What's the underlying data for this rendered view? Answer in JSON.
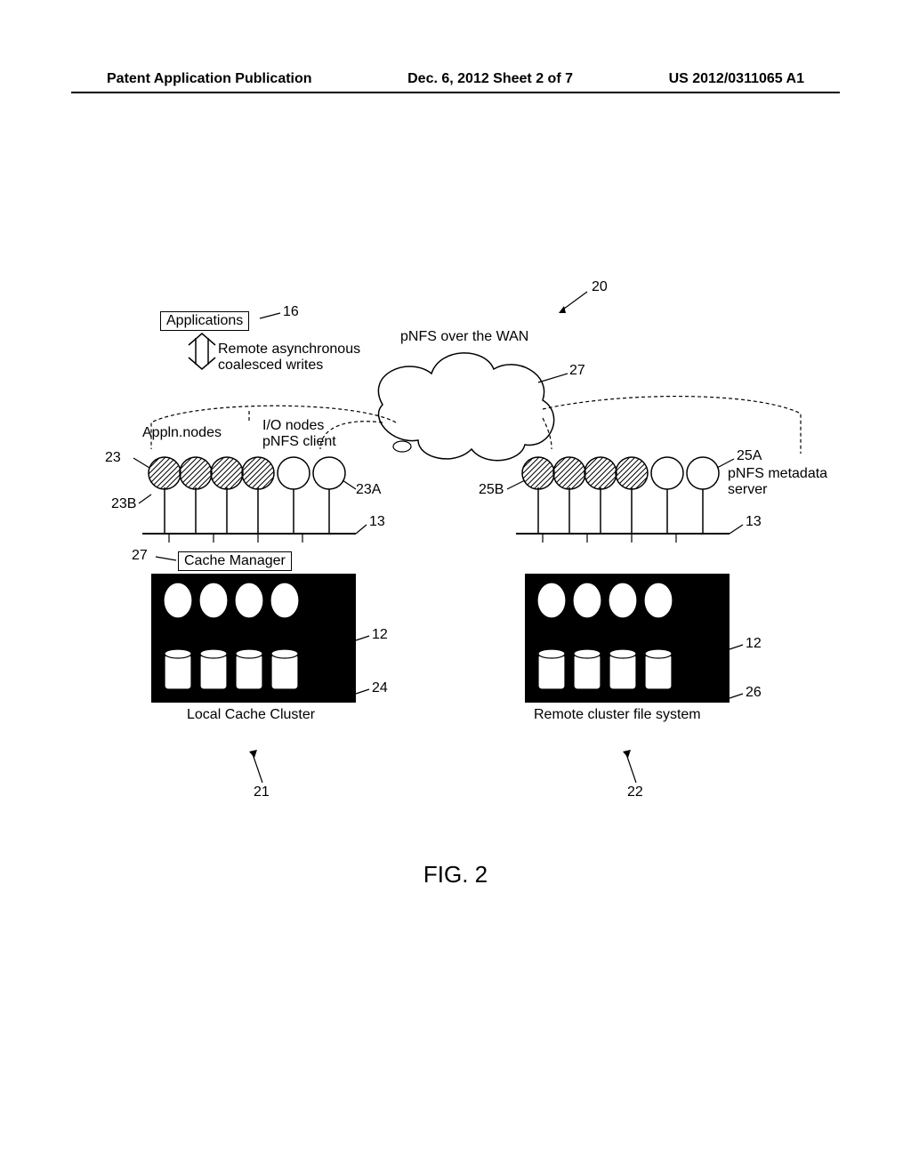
{
  "header": {
    "left": "Patent Application Publication",
    "center": "Dec. 6, 2012  Sheet 2 of 7",
    "right": "US 2012/0311065 A1"
  },
  "figure_label": "FIG. 2",
  "labels": {
    "applications": "Applications",
    "remote_async_l1": "Remote asynchronous",
    "remote_async_l2": "coalesced writes",
    "pnfs_wan": "pNFS over the WAN",
    "appln_nodes": "Appln.nodes",
    "io_nodes_l1": "I/O nodes",
    "io_nodes_l2": "pNFS client",
    "pnfs_meta_l1": "pNFS metadata",
    "pnfs_meta_l2": "server",
    "cache_manager": "Cache Manager",
    "local_cache": "Local Cache Cluster",
    "remote_fs": "Remote cluster file system"
  },
  "refs": {
    "r16": "16",
    "r20": "20",
    "r27a": "27",
    "r27b": "27",
    "r23": "23",
    "r23A": "23A",
    "r23B": "23B",
    "r25A": "25A",
    "r25B": "25B",
    "r13a": "13",
    "r13b": "13",
    "r12a": "12",
    "r12b": "12",
    "r24": "24",
    "r26": "26",
    "r21": "21",
    "r22": "22"
  }
}
